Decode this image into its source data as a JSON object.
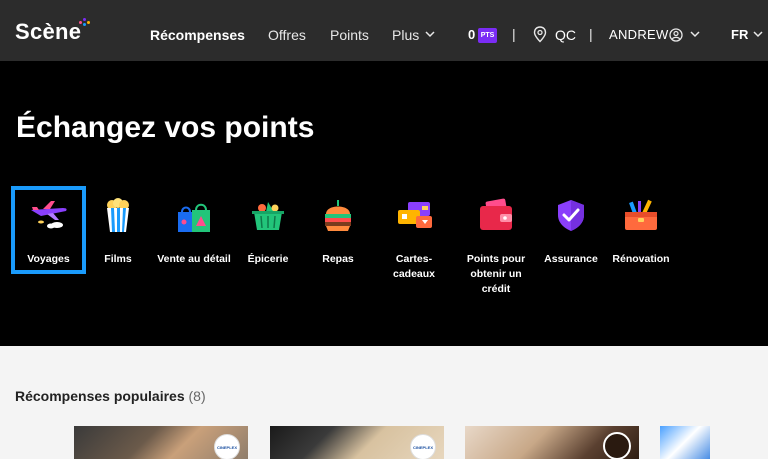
{
  "header": {
    "logo": "Scène",
    "nav": {
      "rewards": "Récompenses",
      "offers": "Offres",
      "points": "Points",
      "more": "Plus"
    },
    "points_value": "0",
    "points_badge": "PTS",
    "separator": "|",
    "province": "QC",
    "user": "ANDREW",
    "language": "FR"
  },
  "hero": {
    "title": "Échangez vos points",
    "categories": [
      {
        "label": "Voyages",
        "icon": "airplane-icon",
        "selected": true
      },
      {
        "label": "Films",
        "icon": "popcorn-icon"
      },
      {
        "label": "Vente au détail",
        "icon": "shopping-bags-icon"
      },
      {
        "label": "Épicerie",
        "icon": "grocery-basket-icon"
      },
      {
        "label": "Repas",
        "icon": "burger-icon"
      },
      {
        "label": "Cartes-cadeaux",
        "icon": "gift-cards-icon"
      },
      {
        "label": "Points pour obtenir un crédit",
        "icon": "wallet-icon"
      },
      {
        "label": "Assurance",
        "icon": "shield-check-icon"
      },
      {
        "label": "Rénovation",
        "icon": "toolbox-icon"
      }
    ]
  },
  "popular": {
    "title": "Récompenses populaires",
    "count": "(8)",
    "card_badge": "CINEPLEX"
  },
  "colors": {
    "header_bg": "#2c2c2c",
    "hero_bg": "#000000",
    "accent_purple": "#7b2cf5",
    "selected_border": "#1a9bfc",
    "section_bg": "#f4f4f4"
  }
}
